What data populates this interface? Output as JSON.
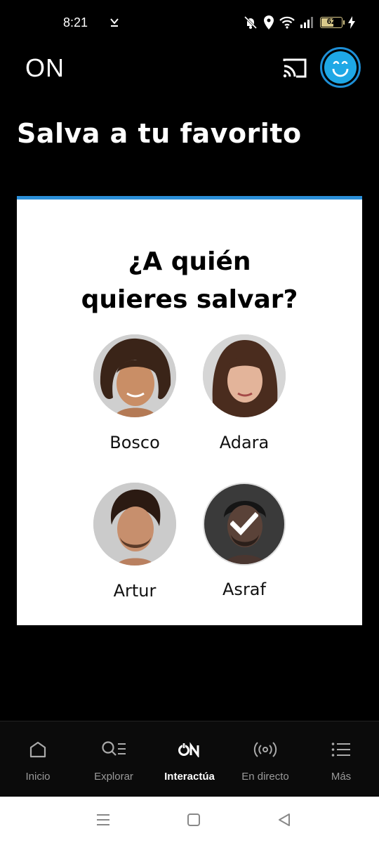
{
  "status_bar": {
    "time": "8:21",
    "battery": "62",
    "battery_level": 0.62
  },
  "header": {
    "brand": "ON"
  },
  "page": {
    "title": "Salva a tu favorito"
  },
  "poll": {
    "question_line1": "¿A quién",
    "question_line2": "quieres salvar?",
    "candidates": [
      {
        "name": "Bosco",
        "selected": false
      },
      {
        "name": "Adara",
        "selected": false
      },
      {
        "name": "Artur",
        "selected": false
      },
      {
        "name": "Asraf",
        "selected": true
      }
    ]
  },
  "nav": {
    "items": [
      {
        "label": "Inicio",
        "icon": "home-icon",
        "active": false
      },
      {
        "label": "Explorar",
        "icon": "search-list-icon",
        "active": false
      },
      {
        "label": "Interactúa",
        "icon": "on-logo-icon",
        "active": true
      },
      {
        "label": "En directo",
        "icon": "live-broadcast-icon",
        "active": false
      },
      {
        "label": "Más",
        "icon": "menu-list-icon",
        "active": false
      }
    ]
  },
  "colors": {
    "accent": "#2b8fd8",
    "avatar": "#1ea8e6",
    "background": "#000000",
    "card": "#ffffff"
  }
}
